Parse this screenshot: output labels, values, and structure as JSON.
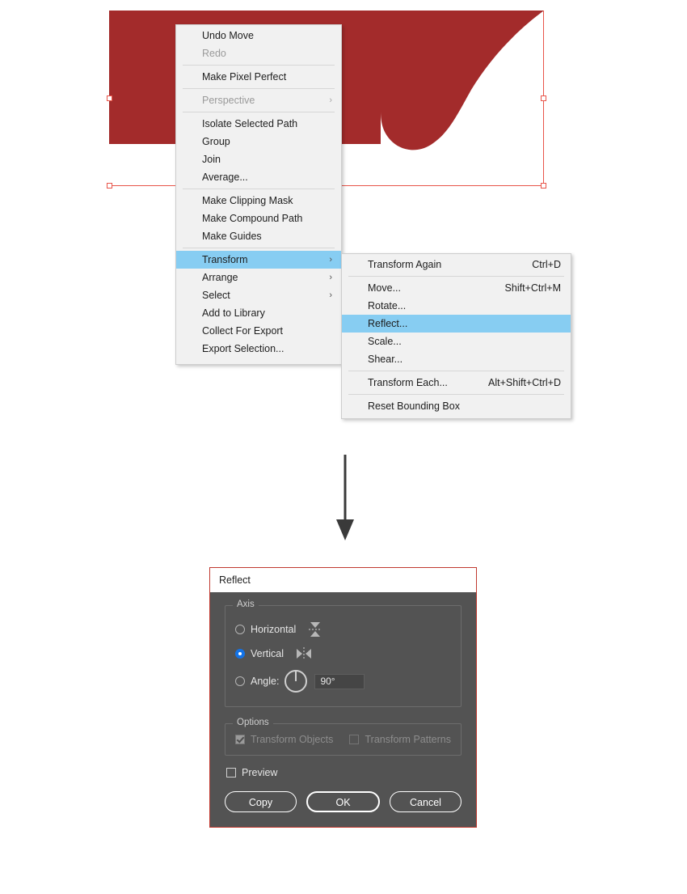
{
  "app": {
    "name": "Adobe Illustrator",
    "accent_blue": "#87cdf2",
    "artwork_fill": "#a32b2b",
    "selection_color": "#e8554a",
    "dialog_accent": "#1473e6",
    "dialog_bg": "#535353"
  },
  "artwork": {
    "shape_name": "reflected-path",
    "fill_color": "#a32b2b",
    "selection_handles": 4
  },
  "context_menu": {
    "name": "canvas-context-menu",
    "items": [
      {
        "label": "Undo Move",
        "shortcut": "",
        "disabled": false,
        "submenu": false,
        "highlighted": false
      },
      {
        "label": "Redo",
        "shortcut": "",
        "disabled": true,
        "submenu": false,
        "highlighted": false
      },
      {
        "separator": true
      },
      {
        "label": "Make Pixel Perfect",
        "shortcut": "",
        "disabled": false,
        "submenu": false,
        "highlighted": false
      },
      {
        "separator": true
      },
      {
        "label": "Perspective",
        "shortcut": "",
        "disabled": true,
        "submenu": true,
        "highlighted": false
      },
      {
        "separator": true
      },
      {
        "label": "Isolate Selected Path",
        "shortcut": "",
        "disabled": false,
        "submenu": false,
        "highlighted": false
      },
      {
        "label": "Group",
        "shortcut": "",
        "disabled": false,
        "submenu": false,
        "highlighted": false
      },
      {
        "label": "Join",
        "shortcut": "",
        "disabled": false,
        "submenu": false,
        "highlighted": false
      },
      {
        "label": "Average...",
        "shortcut": "",
        "disabled": false,
        "submenu": false,
        "highlighted": false
      },
      {
        "separator": true
      },
      {
        "label": "Make Clipping Mask",
        "shortcut": "",
        "disabled": false,
        "submenu": false,
        "highlighted": false
      },
      {
        "label": "Make Compound Path",
        "shortcut": "",
        "disabled": false,
        "submenu": false,
        "highlighted": false
      },
      {
        "label": "Make Guides",
        "shortcut": "",
        "disabled": false,
        "submenu": false,
        "highlighted": false
      },
      {
        "separator": true
      },
      {
        "label": "Transform",
        "shortcut": "",
        "disabled": false,
        "submenu": true,
        "highlighted": true
      },
      {
        "label": "Arrange",
        "shortcut": "",
        "disabled": false,
        "submenu": true,
        "highlighted": false
      },
      {
        "label": "Select",
        "shortcut": "",
        "disabled": false,
        "submenu": true,
        "highlighted": false
      },
      {
        "label": "Add to Library",
        "shortcut": "",
        "disabled": false,
        "submenu": false,
        "highlighted": false
      },
      {
        "label": "Collect For Export",
        "shortcut": "",
        "disabled": false,
        "submenu": false,
        "highlighted": false
      },
      {
        "label": "Export Selection...",
        "shortcut": "",
        "disabled": false,
        "submenu": false,
        "highlighted": false
      }
    ]
  },
  "transform_submenu": {
    "name": "transform-submenu",
    "items": [
      {
        "label": "Transform Again",
        "shortcut": "Ctrl+D",
        "disabled": false,
        "highlighted": false
      },
      {
        "separator": true
      },
      {
        "label": "Move...",
        "shortcut": "Shift+Ctrl+M",
        "disabled": false,
        "highlighted": false
      },
      {
        "label": "Rotate...",
        "shortcut": "",
        "disabled": false,
        "highlighted": false
      },
      {
        "label": "Reflect...",
        "shortcut": "",
        "disabled": false,
        "highlighted": true
      },
      {
        "label": "Scale...",
        "shortcut": "",
        "disabled": false,
        "highlighted": false
      },
      {
        "label": "Shear...",
        "shortcut": "",
        "disabled": false,
        "highlighted": false
      },
      {
        "separator": true
      },
      {
        "label": "Transform Each...",
        "shortcut": "Alt+Shift+Ctrl+D",
        "disabled": false,
        "highlighted": false
      },
      {
        "separator": true
      },
      {
        "label": "Reset Bounding Box",
        "shortcut": "",
        "disabled": false,
        "highlighted": false
      }
    ]
  },
  "flow": {
    "arrow_direction": "down",
    "arrow_name": "down-arrow-icon"
  },
  "reflect_dialog": {
    "title": "Reflect",
    "axis_group_label": "Axis",
    "horizontal_label": "Horizontal",
    "horizontal_selected": false,
    "vertical_label": "Vertical",
    "vertical_selected": true,
    "angle_label": "Angle:",
    "angle_selected": false,
    "angle_value": "90°",
    "options_group_label": "Options",
    "transform_objects_label": "Transform Objects",
    "transform_objects_checked": true,
    "transform_patterns_label": "Transform Patterns",
    "transform_patterns_checked": false,
    "preview_label": "Preview",
    "preview_checked": false,
    "copy_button": "Copy",
    "ok_button": "OK",
    "cancel_button": "Cancel"
  }
}
